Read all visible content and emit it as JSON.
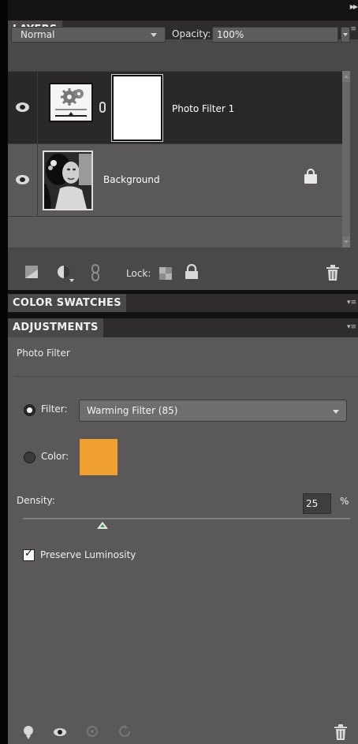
{
  "layers_panel": {
    "tab": "LAYERS",
    "blend_mode": "Normal",
    "opacity_label": "Opacity:",
    "opacity_value": "100%",
    "layers": [
      {
        "name": "Photo Filter 1",
        "visible": true,
        "selected": true,
        "has_mask": true
      },
      {
        "name": "Background",
        "visible": true,
        "selected": false,
        "locked": true
      }
    ],
    "toolbar": {
      "lock_label": "Lock:",
      "icons": [
        "new-layer-icon",
        "adjustment-layer-icon",
        "link-icon",
        "lock-transparent-icon",
        "lock-all-icon",
        "trash-icon"
      ]
    }
  },
  "color_swatches_panel": {
    "tab": "COLOR SWATCHES"
  },
  "adjustments_panel": {
    "tab": "ADJUSTMENTS",
    "subtitle": "Photo Filter",
    "filter_label": "Filter:",
    "filter_value": "Warming Filter (85)",
    "filter_selected": true,
    "color_label": "Color:",
    "color_value": "#f0a030",
    "density_label": "Density:",
    "density_value": "25",
    "density_unit": "%",
    "density_fraction": 0.25,
    "preserve_luminosity_label": "Preserve Luminosity",
    "preserve_luminosity_checked": true,
    "bottom_icons": [
      "clip-icon",
      "visibility-icon",
      "view-previous-icon",
      "reset-icon",
      "trash-icon"
    ]
  },
  "colors": {
    "panel_bg": "#5b5859",
    "selected_row": "#2a2829",
    "tab_bg": "#4b4849",
    "swatch": "#f0a030"
  }
}
